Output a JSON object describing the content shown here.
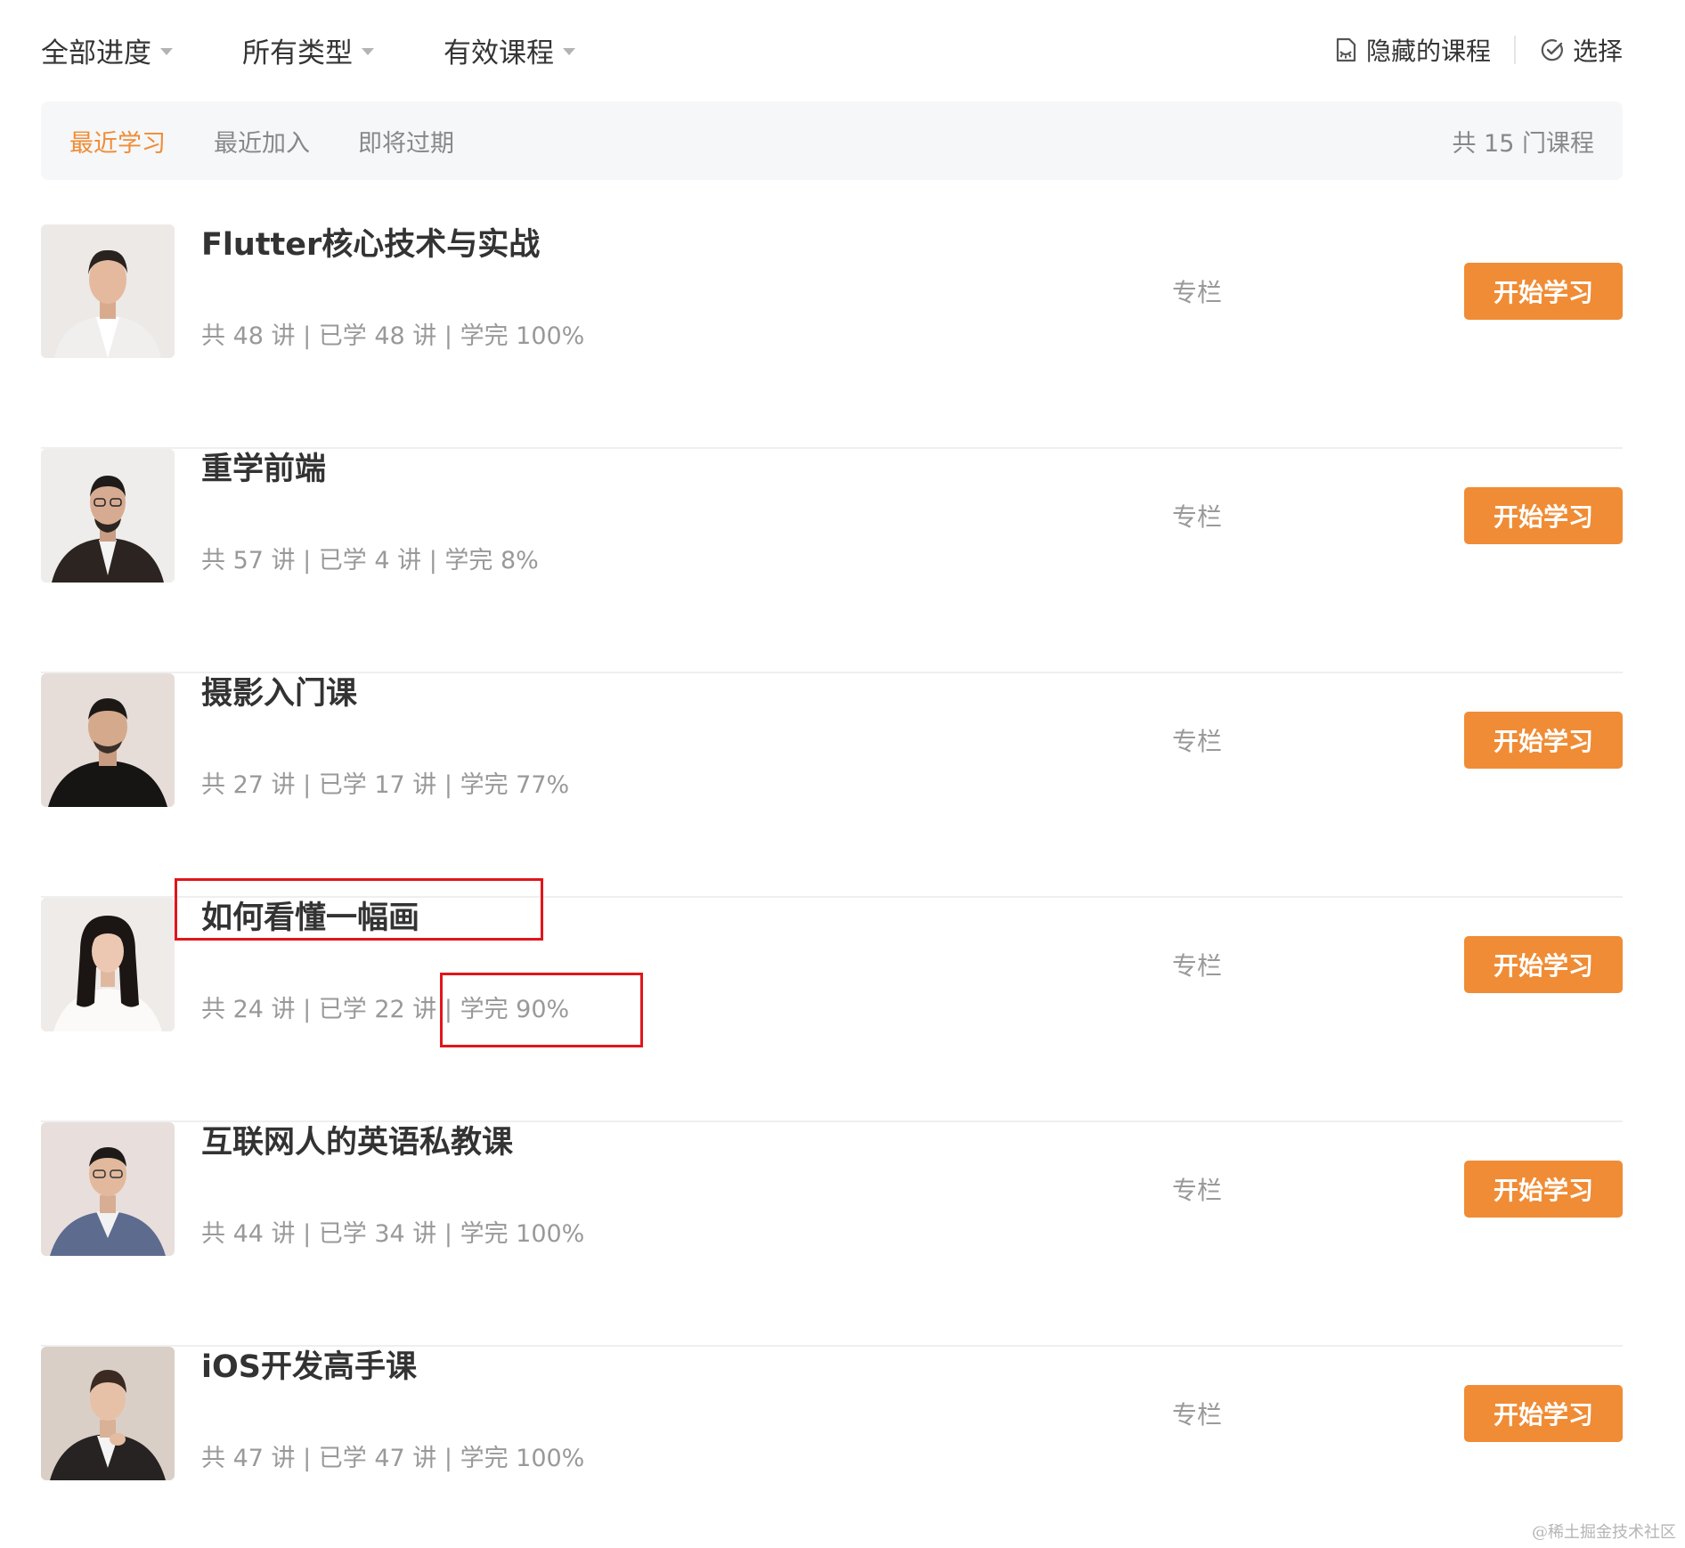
{
  "filters": [
    {
      "label": "全部进度"
    },
    {
      "label": "所有类型"
    },
    {
      "label": "有效课程"
    }
  ],
  "top_actions": {
    "hidden_courses": "隐藏的课程",
    "select": "选择"
  },
  "sort_tabs": [
    {
      "label": "最近学习",
      "active": true
    },
    {
      "label": "最近加入",
      "active": false
    },
    {
      "label": "即将过期",
      "active": false
    }
  ],
  "course_count": "共 15 门课程",
  "courses": [
    {
      "title": "Flutter核心技术与实战",
      "meta": "共 48 讲 | 已学 48 讲 | 学完 100%",
      "type": "专栏",
      "button": "开始学习"
    },
    {
      "title": "重学前端",
      "meta": "共 57 讲 | 已学 4 讲 | 学完 8%",
      "type": "专栏",
      "button": "开始学习"
    },
    {
      "title": "摄影入门课",
      "meta": "共 27 讲 | 已学 17 讲 | 学完 77%",
      "type": "专栏",
      "button": "开始学习"
    },
    {
      "title": "如何看懂一幅画",
      "meta": "共 24 讲 | 已学 22 讲 | 学完 90%",
      "type": "专栏",
      "button": "开始学习"
    },
    {
      "title": "互联网人的英语私教课",
      "meta": "共 44 讲 | 已学 34 讲 | 学完 100%",
      "type": "专栏",
      "button": "开始学习"
    },
    {
      "title": "iOS开发高手课",
      "meta": "共 47 讲 | 已学 47 讲 | 学完 100%",
      "type": "专栏",
      "button": "开始学习"
    }
  ],
  "colors": {
    "accent": "#f08c35",
    "annotation": "#e0161b"
  },
  "watermark": "@稀土掘金技术社区"
}
